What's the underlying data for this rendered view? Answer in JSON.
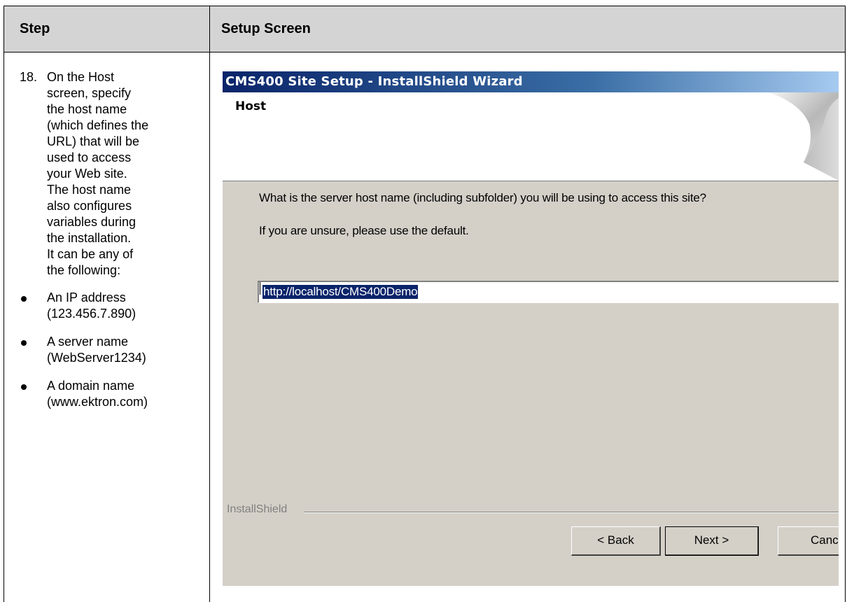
{
  "table": {
    "header_step": "Step",
    "header_setup": "Setup Screen"
  },
  "step": {
    "number": "18.",
    "lines": [
      "On the Host",
      "screen, specify",
      "the host name",
      "(which defines the",
      "URL) that will be",
      "used to access",
      "your Web site.",
      "The host name",
      "also configures",
      "variables during",
      "the installation.",
      "It can be any of",
      "the following:"
    ],
    "bullets": [
      {
        "line1": "An IP address",
        "line2": "(123.456.7.890)"
      },
      {
        "line1": "A server name",
        "line2": "(WebServer1234)"
      },
      {
        "line1": "A domain name",
        "line2": "(www.ektron.com)"
      }
    ]
  },
  "wizard": {
    "title": "CMS400 Site Setup - InstallShield Wizard",
    "page_title": "Host",
    "prompt": "What is the server host name (including subfolder) you will be using to access this site?",
    "hint": "If you are unsure, please use the default.",
    "host_value": "http://localhost/CMS400Demo",
    "brand_label": "InstallShield",
    "back_label": "< Back",
    "next_label": "Next >",
    "cancel_label": "Canc"
  },
  "colors": {
    "titlebar_start": "#0a246a",
    "dialog_bg": "#d4d0c8",
    "header_bg": "#d4d4d4"
  }
}
